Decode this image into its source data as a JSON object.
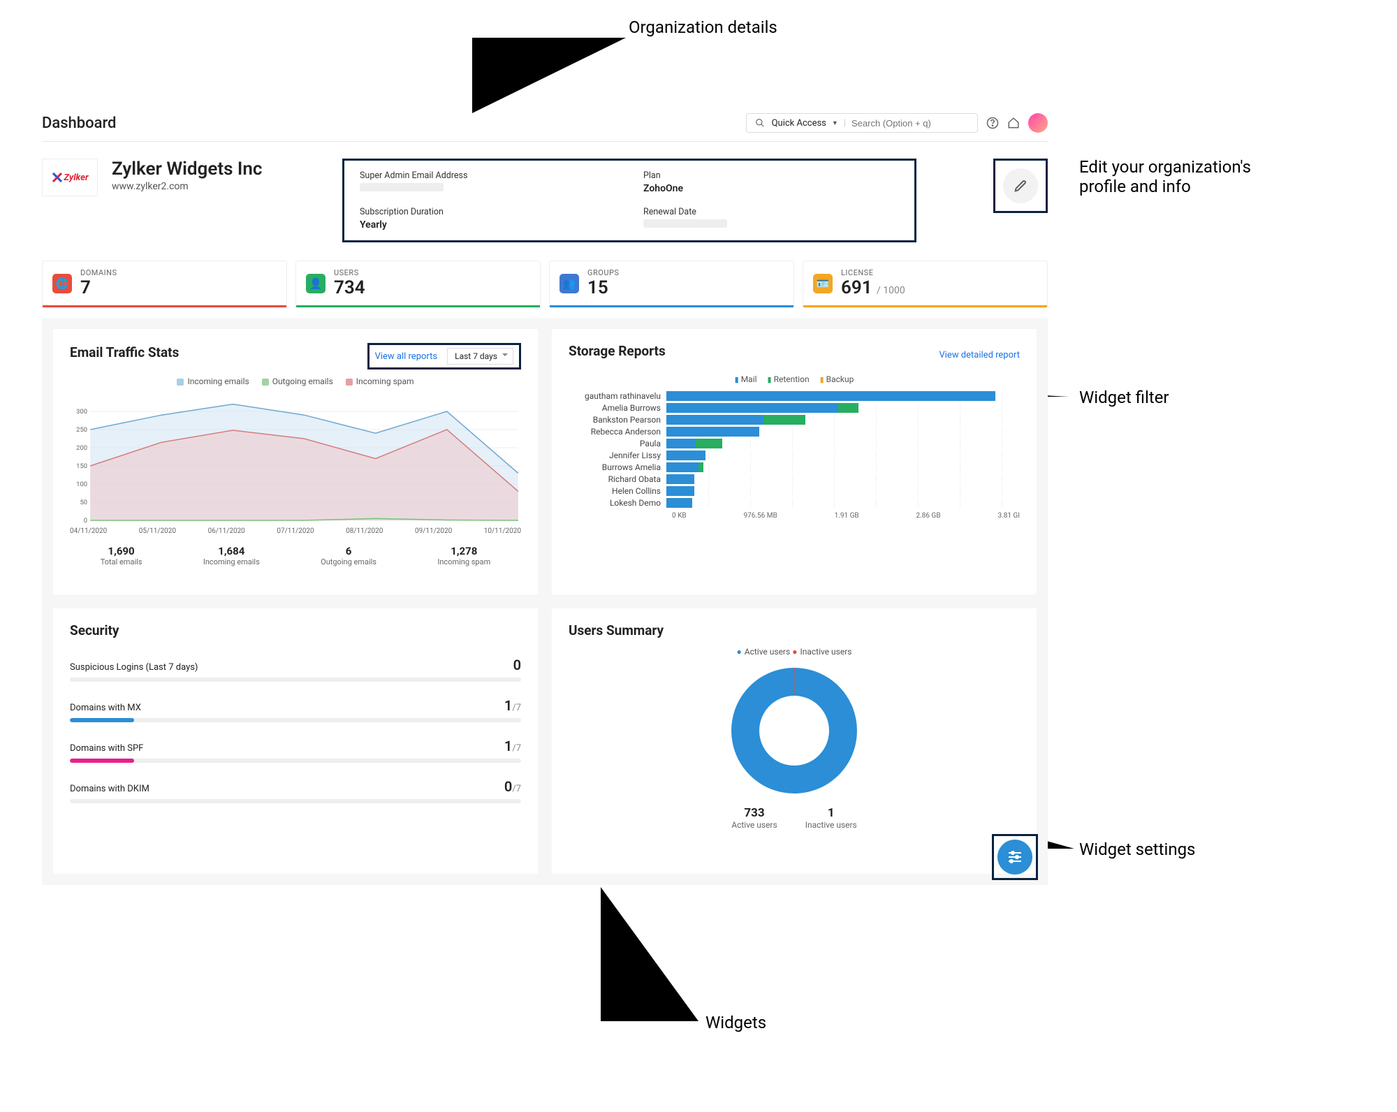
{
  "annotations": {
    "org_details": "Organization details",
    "edit_profile": "Edit your organization's\nprofile and info",
    "widget_filter": "Widget filter",
    "widgets": "Widgets",
    "widget_settings": "Widget settings"
  },
  "header": {
    "title": "Dashboard",
    "quick_access": "Quick Access",
    "search_placeholder": "Search (Option + q)"
  },
  "org": {
    "logo_text": "Zylker",
    "name": "Zylker Widgets Inc",
    "url": "www.zylker2.com",
    "super_admin_label": "Super Admin Email Address",
    "plan_label": "Plan",
    "plan_value": "ZohoOne",
    "sub_label": "Subscription Duration",
    "sub_value": "Yearly",
    "renewal_label": "Renewal Date"
  },
  "stats": {
    "domains": {
      "label": "DOMAINS",
      "value": "7"
    },
    "users": {
      "label": "USERS",
      "value": "734"
    },
    "groups": {
      "label": "GROUPS",
      "value": "15"
    },
    "license": {
      "label": "LICENSE",
      "value": "691",
      "denom": "/ 1000"
    }
  },
  "traffic": {
    "title": "Email Traffic Stats",
    "view_all": "View all reports",
    "range": "Last 7 days",
    "legend": {
      "incoming": "Incoming emails",
      "outgoing": "Outgoing emails",
      "spam": "Incoming spam"
    },
    "summary": {
      "total": {
        "n": "1,690",
        "c": "Total emails"
      },
      "incoming": {
        "n": "1,684",
        "c": "Incoming emails"
      },
      "outgoing": {
        "n": "6",
        "c": "Outgoing emails"
      },
      "spam": {
        "n": "1,278",
        "c": "Incoming spam"
      }
    }
  },
  "storage": {
    "title": "Storage Reports",
    "view_detail": "View detailed report",
    "legend": {
      "mail": "Mail",
      "retention": "Retention",
      "backup": "Backup"
    }
  },
  "security": {
    "title": "Security",
    "rows": {
      "susp": {
        "label": "Suspicious Logins (Last 7 days)",
        "val": "0",
        "denom": ""
      },
      "mx": {
        "label": "Domains with MX",
        "val": "1",
        "denom": "/7"
      },
      "spf": {
        "label": "Domains with SPF",
        "val": "1",
        "denom": "/7"
      },
      "dkim": {
        "label": "Domains with DKIM",
        "val": "0",
        "denom": "/7"
      }
    }
  },
  "users_summary": {
    "title": "Users Summary",
    "legend": {
      "active": "Active users",
      "inactive": "Inactive users"
    },
    "active": {
      "n": "733",
      "c": "Active users"
    },
    "inactive": {
      "n": "1",
      "c": "Inactive users"
    }
  },
  "chart_data": [
    {
      "type": "area",
      "title": "Email Traffic Stats",
      "xlabel": "",
      "ylabel": "",
      "x": [
        "04/11/2020",
        "05/11/2020",
        "06/11/2020",
        "07/11/2020",
        "08/11/2020",
        "09/11/2020",
        "10/11/2020"
      ],
      "ylim": [
        0,
        350
      ],
      "y_ticks": [
        0,
        50,
        100,
        150,
        200,
        250,
        300
      ],
      "series": [
        {
          "name": "Incoming emails",
          "color": "#a9cfe8",
          "values": [
            250,
            290,
            320,
            290,
            240,
            300,
            130
          ]
        },
        {
          "name": "Outgoing emails",
          "color": "#9fd49f",
          "values": [
            0,
            0,
            0,
            0,
            5,
            1,
            0
          ]
        },
        {
          "name": "Incoming spam",
          "color": "#e89fa1",
          "values": [
            150,
            215,
            248,
            225,
            170,
            250,
            80
          ]
        }
      ]
    },
    {
      "type": "bar",
      "orientation": "horizontal",
      "title": "Storage Reports",
      "stacked": true,
      "categories": [
        "gautham rathinavelu",
        "Amelia Burrows",
        "Bankston Pearson",
        "Rebecca Anderson",
        "Paula",
        "Jennifer Lissy",
        "Burrows Amelia",
        "Richard Obata",
        "Helen Collins",
        "Lokesh Demo"
      ],
      "x_ticks": [
        "0 KB",
        "976.56 MB",
        "1.91 GB",
        "2.86 GB",
        "3.81 GI"
      ],
      "xlim_gb": [
        0,
        3.81
      ],
      "series": [
        {
          "name": "Mail",
          "color": "#2b8ed6",
          "values_gb": [
            3.55,
            1.85,
            1.05,
            1.0,
            0.32,
            0.42,
            0.35,
            0.3,
            0.3,
            0.28
          ]
        },
        {
          "name": "Retention",
          "color": "#27ae60",
          "values_gb": [
            0.0,
            0.22,
            0.45,
            0.0,
            0.28,
            0.0,
            0.05,
            0.0,
            0.0,
            0.0
          ]
        },
        {
          "name": "Backup",
          "color": "#f5a623",
          "values_gb": [
            0,
            0,
            0,
            0,
            0,
            0,
            0,
            0,
            0,
            0
          ]
        }
      ]
    },
    {
      "type": "pie",
      "title": "Users Summary",
      "series": [
        {
          "name": "Active users",
          "value": 733,
          "color": "#2b8ed6"
        },
        {
          "name": "Inactive users",
          "value": 1,
          "color": "#e74c3c"
        }
      ]
    }
  ]
}
